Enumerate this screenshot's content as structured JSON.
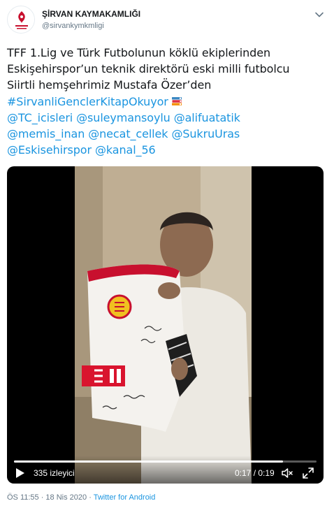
{
  "user": {
    "display_name": "ŞİRVAN KAYMAKAMLIĞI",
    "handle": "@sirvankymkmligi",
    "avatar_icon": "crest-logo"
  },
  "tweet": {
    "line1": "TFF 1.Lig ve Türk Futbolunun köklü ekiplerinden",
    "line2": "Eskişehirspor’un teknik direktörü eski milli futbolcu",
    "line3": "Siirtli hemşehrimiz Mustafa Özer’den",
    "emoji_icon": "books-icon",
    "hashtag": "#SirvanliGenclerKitapOkuyor",
    "mentions": [
      "@TC_icisleri",
      "@suleymansoylu",
      "@alifuatatik",
      "@memis_inan",
      "@necat_cellek",
      "@SukruUras",
      "@Eskisehirspor",
      "@kanal_56"
    ]
  },
  "video": {
    "views_label": "335 izleyici",
    "time_label": "0:17 / 0:19",
    "progress_fraction": 0.89
  },
  "meta": {
    "timestamp": "ÖS 11:55 · 18 Nis 2020 · ",
    "source": "Twitter for Android"
  },
  "colors": {
    "link": "#1b95e0",
    "text": "#14171a",
    "secondary": "#657786"
  }
}
